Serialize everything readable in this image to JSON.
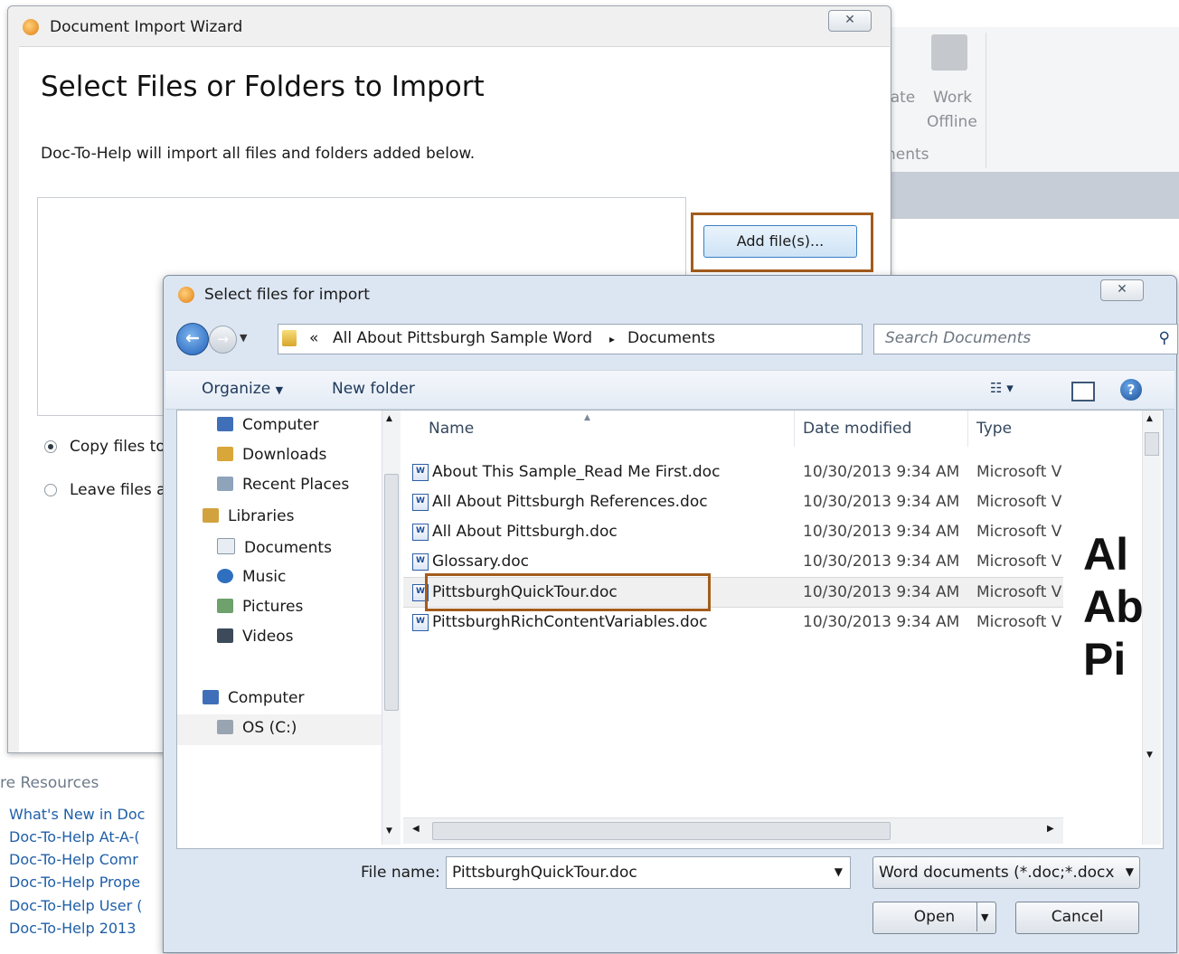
{
  "background_app": {
    "ribbon_items": [
      "late",
      "Work",
      "Offline"
    ],
    "ribbon_group": "nents",
    "resources_header": "re Resources",
    "links": [
      "What's New in Doc",
      "Doc-To-Help At-A-(",
      "Doc-To-Help Comr",
      "Doc-To-Help Prope",
      "Doc-To-Help User (",
      "Doc-To-Help 2013"
    ]
  },
  "wizard": {
    "title": "Document Import Wizard",
    "close": "✕",
    "heading": "Select Files or Folders to Import",
    "subtitle": "Doc-To-Help will import all files and folders added below.",
    "add_button": "Add file(s)...",
    "option_copy": "Copy files to",
    "option_leave": "Leave files at",
    "selected_option": "copy"
  },
  "dialog": {
    "title": "Select files for import",
    "close": "✕",
    "breadcrumb": {
      "prefix": "«",
      "folder": "All About Pittsburgh Sample Word",
      "separator": "▸",
      "current": "Documents"
    },
    "search_placeholder": "Search Documents",
    "toolbar": {
      "organize": "Organize",
      "new_folder": "New folder"
    },
    "nav_items": [
      {
        "label": "Computer",
        "icon": "computer-icon"
      },
      {
        "label": "Downloads",
        "icon": "downloads-icon"
      },
      {
        "label": "Recent Places",
        "icon": "recent-places-icon"
      },
      {
        "label": "Libraries",
        "icon": "libraries-icon"
      },
      {
        "label": "Documents",
        "icon": "documents-icon"
      },
      {
        "label": "Music",
        "icon": "music-icon"
      },
      {
        "label": "Pictures",
        "icon": "pictures-icon"
      },
      {
        "label": "Videos",
        "icon": "videos-icon"
      },
      {
        "label": "Computer",
        "icon": "computer-icon"
      },
      {
        "label": "OS (C:)",
        "icon": "drive-icon"
      }
    ],
    "columns": {
      "name": "Name",
      "date": "Date modified",
      "type": "Type"
    },
    "files": [
      {
        "name": "About This Sample_Read Me First.doc",
        "date": "10/30/2013 9:34 AM",
        "type": "Microsoft V"
      },
      {
        "name": "All About Pittsburgh References.doc",
        "date": "10/30/2013 9:34 AM",
        "type": "Microsoft V"
      },
      {
        "name": "All About Pittsburgh.doc",
        "date": "10/30/2013 9:34 AM",
        "type": "Microsoft V"
      },
      {
        "name": "Glossary.doc",
        "date": "10/30/2013 9:34 AM",
        "type": "Microsoft V"
      },
      {
        "name": "PittsburghQuickTour.doc",
        "date": "10/30/2013 9:34 AM",
        "type": "Microsoft V"
      },
      {
        "name": "PittsburghRichContentVariables.doc",
        "date": "10/30/2013 9:34 AM",
        "type": "Microsoft V"
      }
    ],
    "preview_text": [
      "Al",
      "Ab",
      "Pi"
    ],
    "file_name_label": "File name:",
    "file_name_value": "PittsburghQuickTour.doc",
    "filter_value": "Word documents (*.doc;*.docx",
    "open_button": "Open",
    "cancel_button": "Cancel"
  }
}
